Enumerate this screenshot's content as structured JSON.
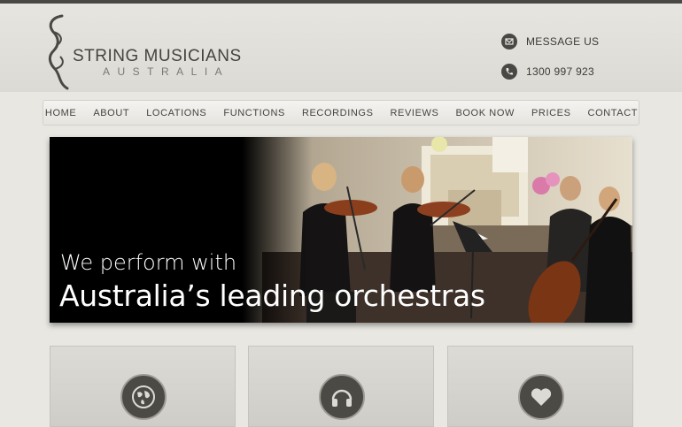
{
  "brand": {
    "title": "STRING MUSICIANS",
    "subtitle": "AUSTRALIA"
  },
  "contact": {
    "message_label": "MESSAGE US",
    "phone": "1300 997 923",
    "message_icon": "envelope-icon",
    "phone_icon": "phone-icon"
  },
  "nav": {
    "items": [
      {
        "label": "HOME"
      },
      {
        "label": "ABOUT"
      },
      {
        "label": "LOCATIONS"
      },
      {
        "label": "FUNCTIONS"
      },
      {
        "label": "RECORDINGS"
      },
      {
        "label": "REVIEWS"
      },
      {
        "label": "BOOK NOW"
      },
      {
        "label": "PRICES"
      },
      {
        "label": "CONTACT"
      }
    ]
  },
  "hero": {
    "line1": "We perform with",
    "line2": "Australia’s leading orchestras"
  },
  "cards": [
    {
      "icon": "globe-icon"
    },
    {
      "icon": "headphones-icon"
    },
    {
      "icon": "heart-icon"
    }
  ],
  "colors": {
    "background": "#e9e7e2",
    "dark": "#4a4844",
    "hero_text": "#ffffff"
  }
}
